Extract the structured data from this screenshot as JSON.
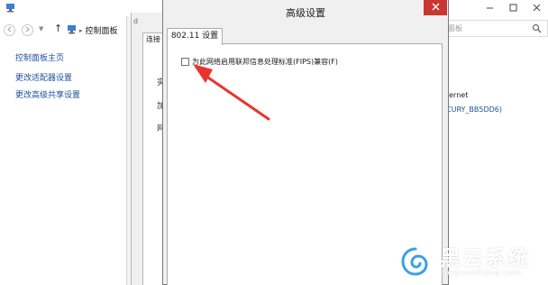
{
  "control_panel": {
    "window_title_fragment": "",
    "breadcrumb": {
      "root": "控制面板",
      "separator": "▸"
    },
    "search_placeholder": "面板",
    "sidebar": {
      "home": "控制面板主页",
      "items": [
        {
          "label": "更改适配器设置"
        },
        {
          "label": "更改高级共享设置"
        }
      ]
    },
    "connection": {
      "access_fragment": "ternet",
      "network_link_fragment": "CURY_BB5DD6)"
    }
  },
  "status_dialog": {
    "title_fragment": "d",
    "tab_fragment": "连接",
    "fragments": [
      "实",
      "加",
      "网"
    ]
  },
  "advanced_dialog": {
    "title": "高级设置",
    "tab_label": "802.11 设置",
    "fips_checkbox": {
      "label": "为此网络启用联邦信息处理标准(FIPS)兼容(F)",
      "checked": false
    }
  },
  "annotation": {
    "color": "#e8352b"
  },
  "watermark": {
    "name": "黑云系统",
    "domain": "heiyunxitong.com",
    "color": "#3aa0e6"
  },
  "icons": {
    "close": "close-icon",
    "minimize": "minimize-icon",
    "maximize": "maximize-icon",
    "back": "back-arrow-icon",
    "forward": "forward-arrow-icon",
    "up": "up-arrow-icon",
    "search": "search-icon",
    "control_panel": "control-panel-icon"
  }
}
